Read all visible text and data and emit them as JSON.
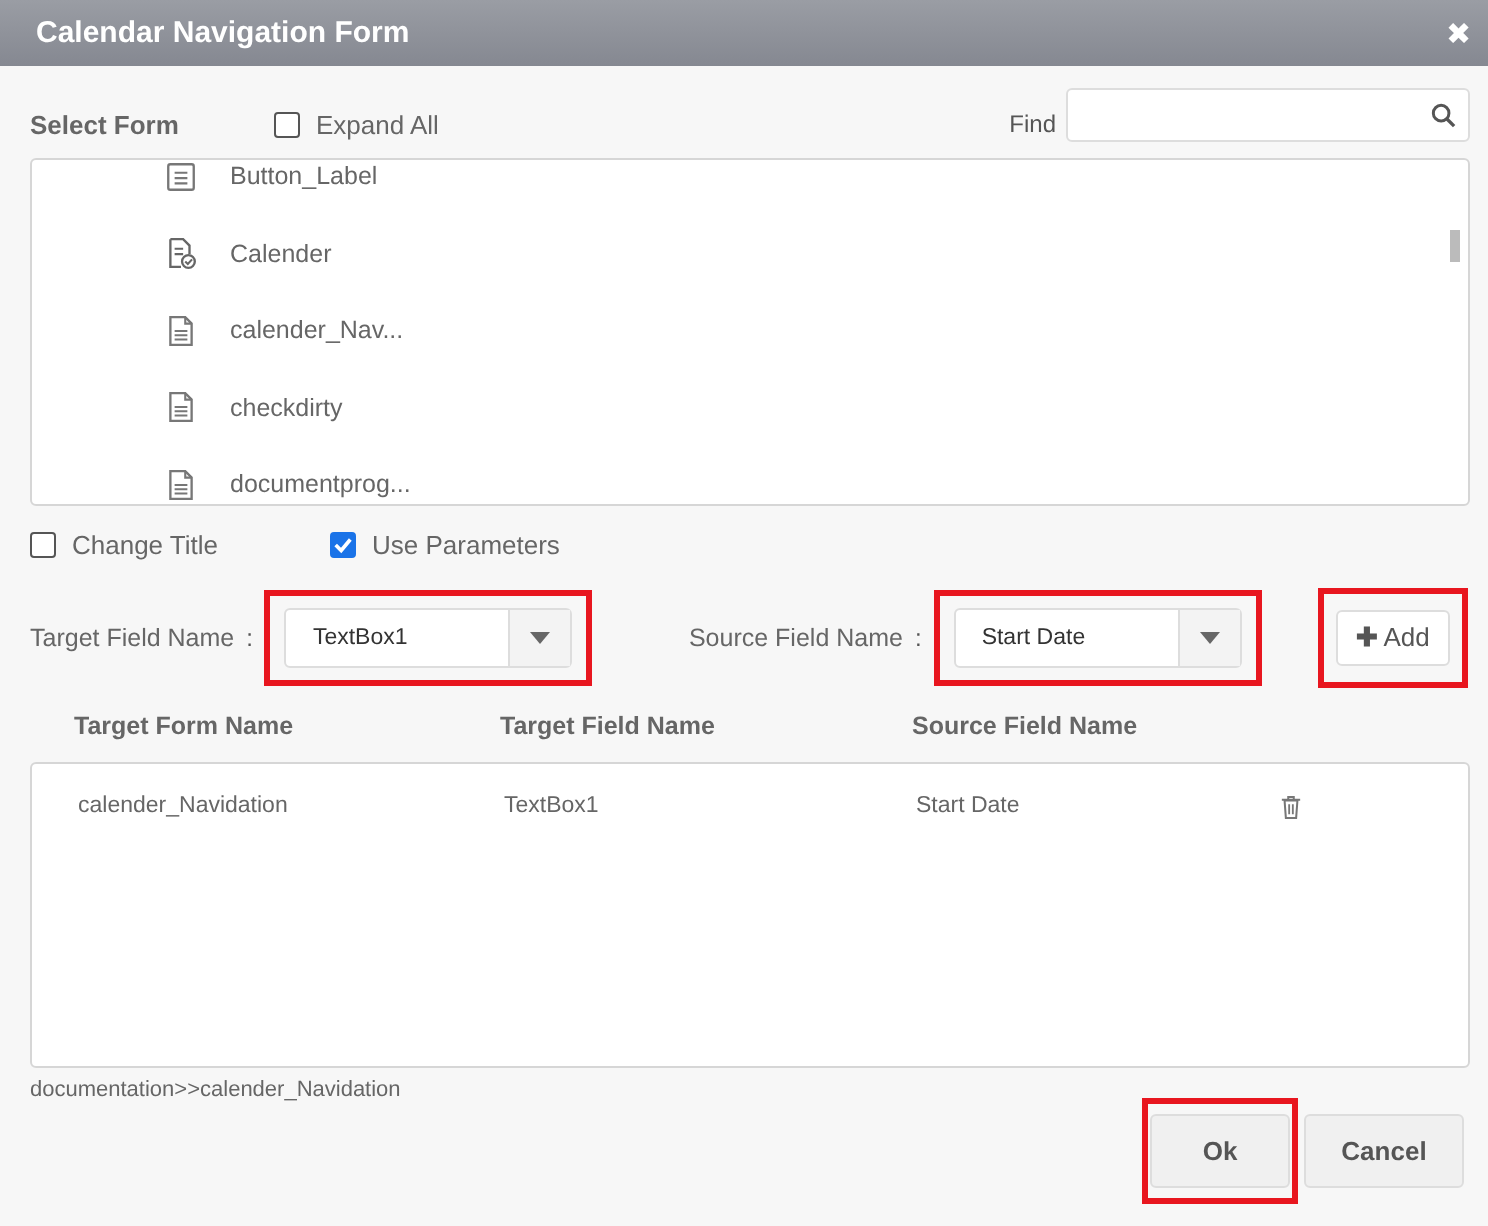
{
  "window": {
    "title": "Calendar Navigation Form",
    "close": "✖"
  },
  "select_form": {
    "label": "Select Form",
    "expand_all": {
      "label": "Expand All",
      "checked": false
    },
    "find_label": "Find"
  },
  "forms": [
    {
      "name": "Button_Label",
      "kind": "list"
    },
    {
      "name": "Calender",
      "kind": "calendar"
    },
    {
      "name": "calender_Nav...",
      "kind": "doc"
    },
    {
      "name": "checkdirty",
      "kind": "doc"
    },
    {
      "name": "documentprog...",
      "kind": "doc"
    }
  ],
  "options": [
    {
      "label": "Change Title",
      "checked": false
    },
    {
      "label": "Use Parameters",
      "checked": true
    }
  ],
  "target_field": {
    "label": "Target Field Name",
    "colon": ":",
    "value": "TextBox1",
    "highlighted": true
  },
  "source_field": {
    "label": "Source Field Name",
    "colon": ":",
    "value": "Start Date",
    "highlighted": true
  },
  "add_button": {
    "icon": "✚",
    "label": "Add",
    "highlighted": true
  },
  "table": {
    "columns": [
      "Target Form Name",
      "Target Field Name",
      "Source Field Name"
    ],
    "rows": [
      {
        "cells": [
          "calender_Navidation",
          "TextBox1",
          "Start Date"
        ]
      }
    ]
  },
  "path": "documentation>>calender_Navidation",
  "buttons": [
    {
      "label": "Ok",
      "highlighted": true
    },
    {
      "label": "Cancel",
      "highlighted": false
    }
  ]
}
